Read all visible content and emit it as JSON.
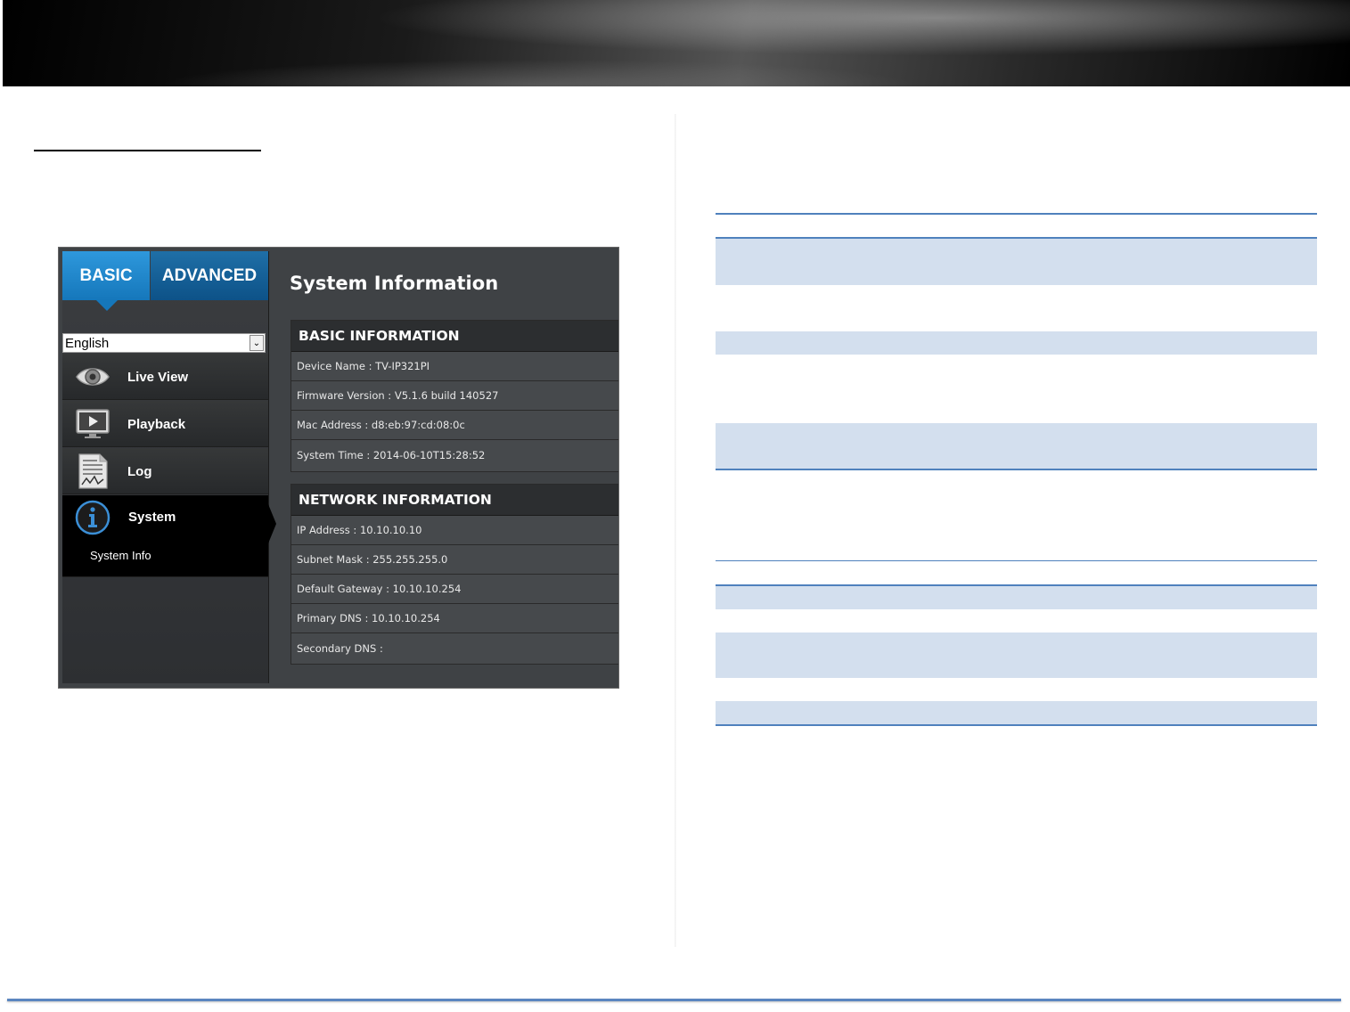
{
  "screenshot": {
    "tabs": {
      "basic": "BASIC",
      "advanced": "ADVANCED"
    },
    "language": {
      "selected": "English"
    },
    "menu": [
      {
        "label": "Live View",
        "icon": "eye-icon"
      },
      {
        "label": "Playback",
        "icon": "play-monitor-icon"
      },
      {
        "label": "Log",
        "icon": "log-document-icon"
      },
      {
        "label": "System",
        "icon": "info-icon"
      }
    ],
    "submenu": {
      "system_info": "System Info"
    },
    "page_title": "System Information",
    "basic_info": {
      "header": "BASIC INFORMATION",
      "rows": [
        "Device Name : TV-IP321PI",
        "Firmware Version : V5.1.6 build 140527",
        "Mac Address : d8:eb:97:cd:08:0c",
        "System Time : 2014-06-10T15:28:52"
      ]
    },
    "network_info": {
      "header": "NETWORK INFORMATION",
      "rows": [
        "IP Address : 10.10.10.10",
        "Subnet Mask : 255.255.255.0",
        "Default Gateway : 10.10.10.254",
        "Primary DNS : 10.10.10.254",
        "Secondary DNS :"
      ]
    }
  },
  "colors": {
    "accent_blue": "#1577bb",
    "table_band": "#d3dfee",
    "table_rule": "#4f81bd"
  }
}
